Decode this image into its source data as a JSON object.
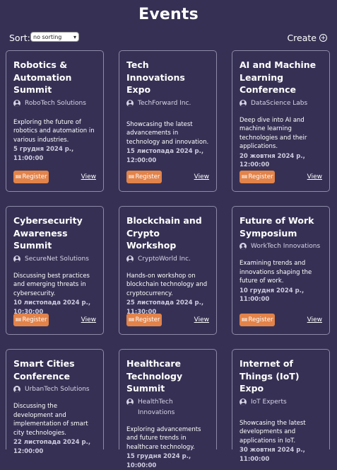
{
  "page": {
    "title": "Events"
  },
  "toolbar": {
    "sort_label": "Sort:",
    "sort_selected": "no sorting",
    "create_label": "Create"
  },
  "card_actions": {
    "register_label": "Register",
    "view_label": "View"
  },
  "events": [
    {
      "title": "Robotics & Automation Summit",
      "org": "RoboTech Solutions",
      "description": "Exploring the future of robotics and automation in various industries.",
      "date": "5 грудня 2024 р., 11:00:00"
    },
    {
      "title": "Tech Innovations Expo",
      "org": "TechForward Inc.",
      "description": "Showcasing the latest advancements in technology and innovation.",
      "date": "15 листопада 2024 р., 12:00:00"
    },
    {
      "title": "AI and Machine Learning Conference",
      "org": "DataScience Labs",
      "description": "Deep dive into AI and machine learning technologies and their applications.",
      "date": "20 жовтня 2024 р., 12:00:00"
    },
    {
      "title": "Cybersecurity Awareness Summit",
      "org": "SecureNet Solutions",
      "description": "Discussing best practices and emerging threats in cybersecurity.",
      "date": "10 листопада 2024 р., 10:30:00"
    },
    {
      "title": "Blockchain and Crypto Workshop",
      "org": "CryptoWorld Inc.",
      "description": "Hands-on workshop on blockchain technology and cryptocurrency.",
      "date": "25 листопада 2024 р., 11:30:00"
    },
    {
      "title": "Future of Work Symposium",
      "org": "WorkTech Innovations",
      "description": "Examining trends and innovations shaping the future of work.",
      "date": "10 грудня 2024 р., 11:00:00"
    },
    {
      "title": "Smart Cities Conference",
      "org": "UrbanTech Solutions",
      "description": "Discussing the development and implementation of smart city technologies.",
      "date": "22 листопада 2024 р., 12:00:00"
    },
    {
      "title": "Healthcare Technology Summit",
      "org": "HealthTech Innovations",
      "description": "Exploring advancements and future trends in healthcare technology.",
      "date": "15 грудня 2024 р., 10:00:00"
    },
    {
      "title": "Internet of Things (IoT) Expo",
      "org": "IoT Experts",
      "description": "Showcasing the latest developments and applications in IoT.",
      "date": "30 жовтня 2024 р., 11:00:00"
    }
  ]
}
